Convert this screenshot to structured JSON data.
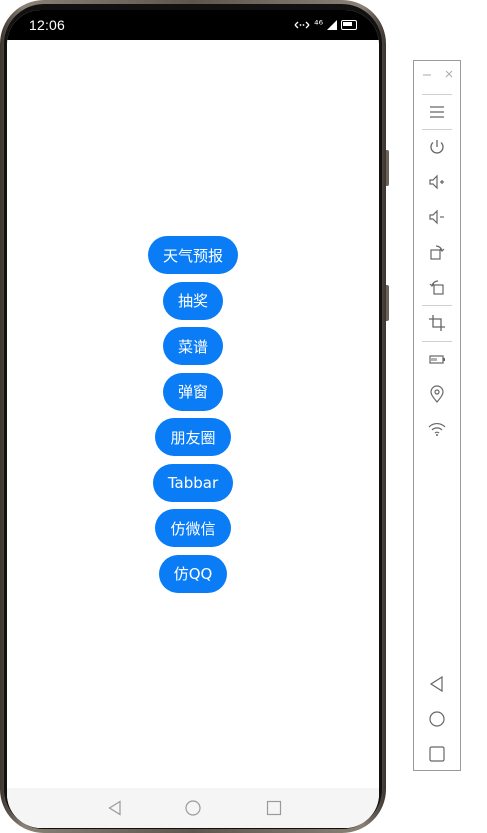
{
  "status_bar": {
    "time": "12:06",
    "signal_text": "⁴⁶"
  },
  "buttons": [
    {
      "label": "天气预报"
    },
    {
      "label": "抽奖"
    },
    {
      "label": "菜谱"
    },
    {
      "label": "弹窗"
    },
    {
      "label": "朋友圈"
    },
    {
      "label": "Tabbar"
    },
    {
      "label": "仿微信"
    },
    {
      "label": "仿QQ"
    }
  ],
  "colors": {
    "accent": "#0a7cf5",
    "status_bar": "#000000",
    "nav_bar": "#f5f5f5"
  },
  "nav_icons": [
    "back-icon",
    "home-icon",
    "recent-apps-icon"
  ],
  "toolbar_icons": [
    "minimize-icon",
    "close-icon",
    "menu-icon",
    "power-icon",
    "volume-up-icon",
    "volume-down-icon",
    "rotate-right-icon",
    "rotate-left-icon",
    "crop-icon",
    "battery-icon",
    "location-icon",
    "wifi-icon",
    "back-icon",
    "home-icon",
    "overview-icon"
  ]
}
